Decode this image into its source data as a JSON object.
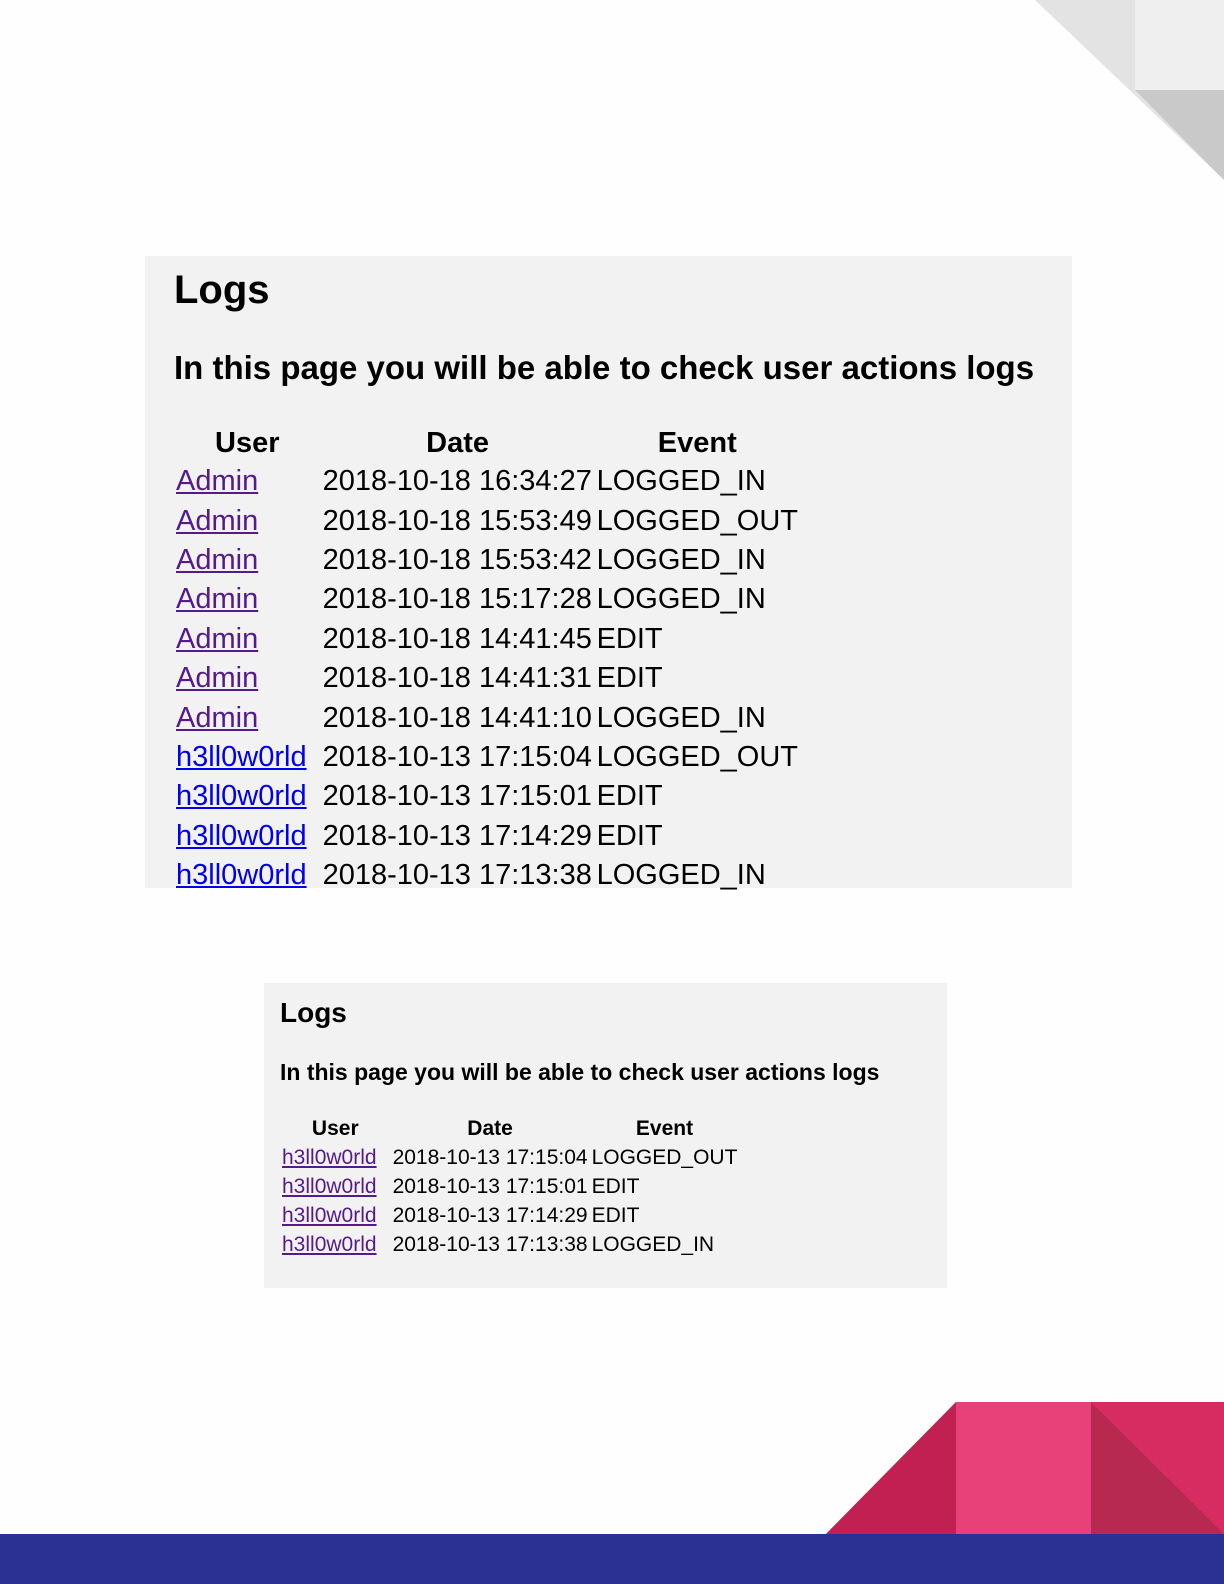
{
  "colors": {
    "page_background": "#fefefe",
    "screenshot_background": "#f2f2f2",
    "visited_link": "#551a8b",
    "unvisited_link": "#0000ee",
    "corner_gray_light": "#e6e6e6",
    "corner_gray_dark": "#c8c8c8",
    "accent_pink": "#e8417a",
    "accent_crimson": "#c21f52",
    "footer_navy": "#2b3190"
  },
  "screenshot_large": {
    "title": "Logs",
    "subtitle": "In this page you will be able to check user actions logs",
    "columns": [
      "User",
      "Date",
      "Event"
    ],
    "rows": [
      {
        "user": "Admin",
        "date": "2018-10-18 16:34:27",
        "event": "LOGGED_IN"
      },
      {
        "user": "Admin",
        "date": "2018-10-18 15:53:49",
        "event": "LOGGED_OUT"
      },
      {
        "user": "Admin",
        "date": "2018-10-18 15:53:42",
        "event": "LOGGED_IN"
      },
      {
        "user": "Admin",
        "date": "2018-10-18 15:17:28",
        "event": "LOGGED_IN"
      },
      {
        "user": "Admin",
        "date": "2018-10-18 14:41:45",
        "event": "EDIT"
      },
      {
        "user": "Admin",
        "date": "2018-10-18 14:41:31",
        "event": "EDIT"
      },
      {
        "user": "Admin",
        "date": "2018-10-18 14:41:10",
        "event": "LOGGED_IN"
      },
      {
        "user": "h3ll0w0rld",
        "date": "2018-10-13 17:15:04",
        "event": "LOGGED_OUT"
      },
      {
        "user": "h3ll0w0rld",
        "date": "2018-10-13 17:15:01",
        "event": "EDIT"
      },
      {
        "user": "h3ll0w0rld",
        "date": "2018-10-13 17:14:29",
        "event": "EDIT"
      },
      {
        "user": "h3ll0w0rld",
        "date": "2018-10-13 17:13:38",
        "event": "LOGGED_IN"
      }
    ]
  },
  "screenshot_small": {
    "title": "Logs",
    "subtitle": "In this page you will be able to check user actions logs",
    "columns": [
      "User",
      "Date",
      "Event"
    ],
    "rows": [
      {
        "user": "h3ll0w0rld",
        "date": "2018-10-13 17:15:04",
        "event": "LOGGED_OUT"
      },
      {
        "user": "h3ll0w0rld",
        "date": "2018-10-13 17:15:01",
        "event": "EDIT"
      },
      {
        "user": "h3ll0w0rld",
        "date": "2018-10-13 17:14:29",
        "event": "EDIT"
      },
      {
        "user": "h3ll0w0rld",
        "date": "2018-10-13 17:13:38",
        "event": "LOGGED_IN"
      }
    ]
  }
}
